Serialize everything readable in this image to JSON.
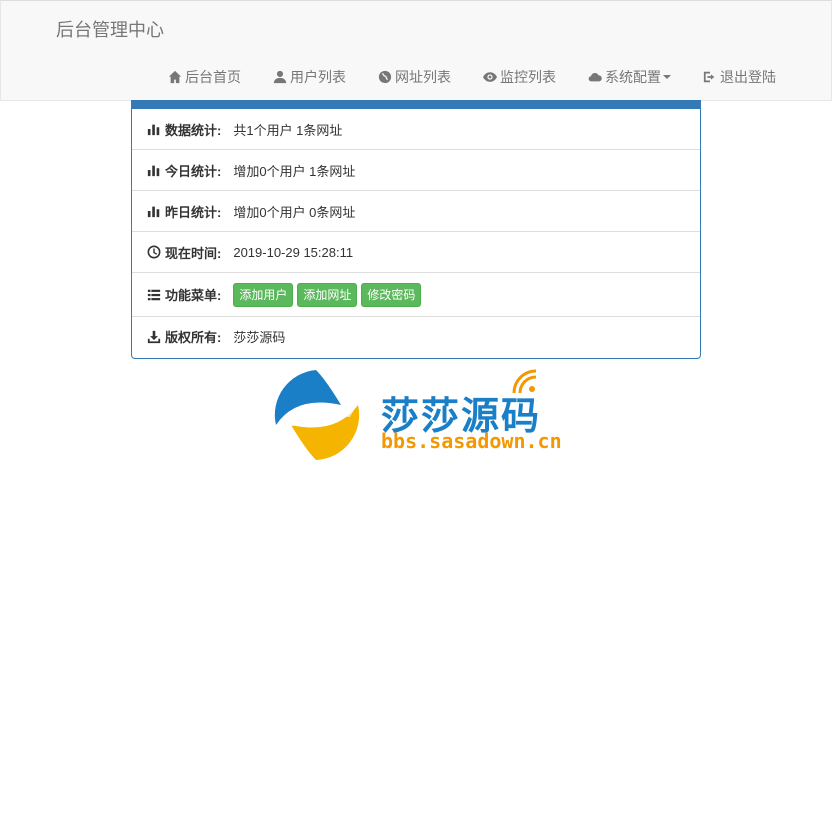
{
  "brand": "后台管理中心",
  "nav": [
    {
      "label": "后台首页",
      "icon": "home-icon"
    },
    {
      "label": "用户列表",
      "icon": "user-icon"
    },
    {
      "label": "网址列表",
      "icon": "globe-icon"
    },
    {
      "label": "监控列表",
      "icon": "eye-icon"
    },
    {
      "label": "系统配置",
      "icon": "cloud-icon"
    },
    {
      "label": "退出登陆",
      "icon": "logout-icon"
    }
  ],
  "panel": {
    "stats": {
      "label": "数据统计:",
      "value": "共1个用户 1条网址"
    },
    "today": {
      "label": "今日统计:",
      "value": "增加0个用户 1条网址"
    },
    "yesterday": {
      "label": "昨日统计:",
      "value": "增加0个用户 0条网址"
    },
    "time": {
      "label": "现在时间:",
      "value": "2019-10-29 15:28:11"
    },
    "menu": {
      "label": "功能菜单:",
      "buttons": [
        "添加用户",
        "添加网址",
        "修改密码"
      ]
    },
    "copyright": {
      "label": "版权所有:",
      "value": "莎莎源码"
    }
  },
  "logo": {
    "name": "莎莎源码",
    "url": "bbs.sasadown.cn"
  },
  "colors": {
    "primary": "#337ab7",
    "success": "#5cb85c",
    "brand_blue": "#1a7fc7",
    "brand_orange": "#f39800"
  }
}
